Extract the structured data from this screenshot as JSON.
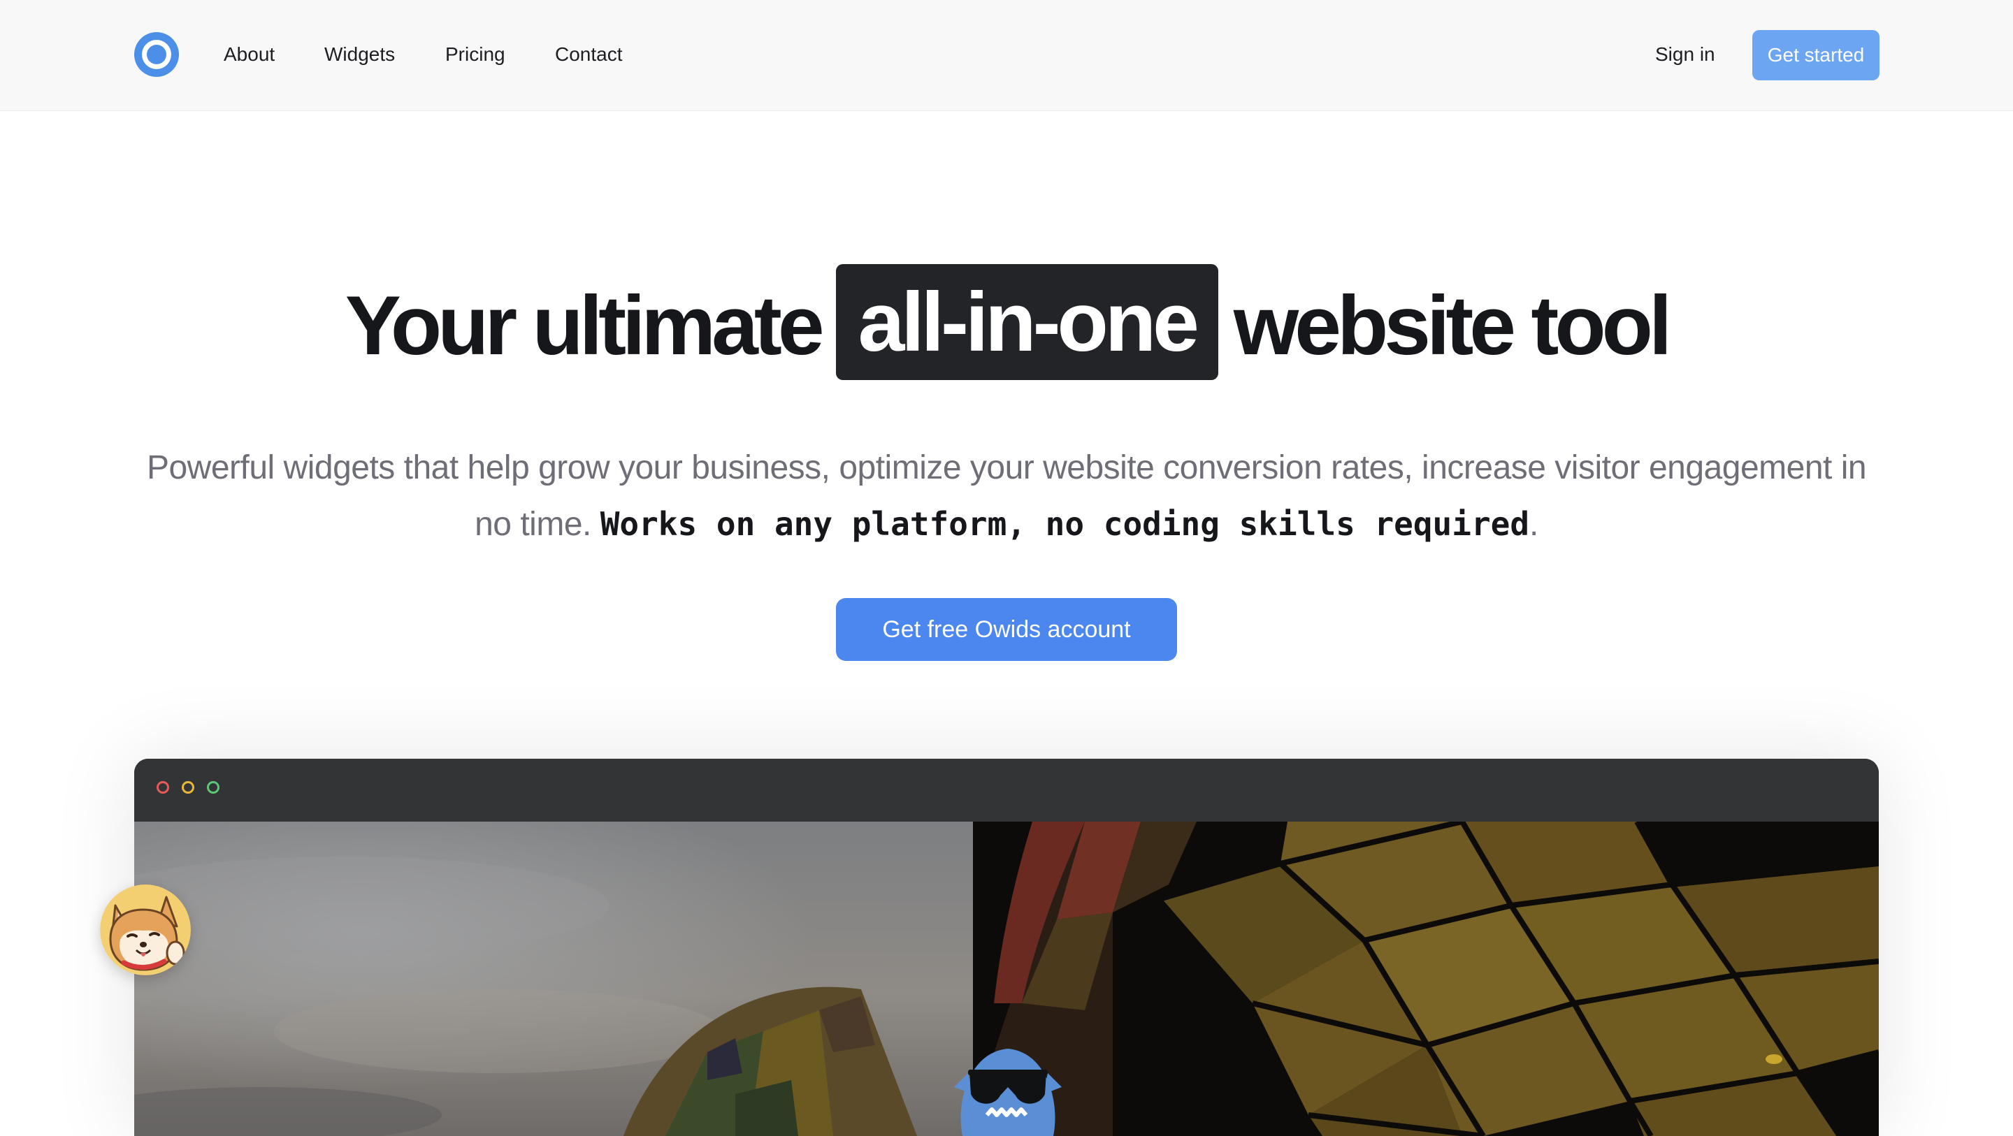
{
  "header": {
    "logo": "owids-logo-icon",
    "nav": {
      "about": "About",
      "widgets": "Widgets",
      "pricing": "Pricing",
      "contact": "Contact"
    },
    "sign_in": "Sign in",
    "get_started": "Get started"
  },
  "hero": {
    "title_pre": "Your ultimate",
    "title_highlight": "all-in-one",
    "title_post": "website tool",
    "subtitle_plain": "Powerful widgets that help grow your business, optimize your website conversion rates, increase visitor engagement in no time.",
    "subtitle_bold": "Works on any platform, no coding skills required",
    "subtitle_end": ".",
    "cta": "Get free Owids account"
  },
  "browser": {
    "window_controls": [
      "close",
      "minimize",
      "maximize"
    ],
    "content_image": "hot-air-balloon-photo",
    "mascot": "sunglasses-mascot-icon"
  },
  "avatar": {
    "icon": "dog-mascot-avatar-icon"
  },
  "colors": {
    "accent": "#4b87ef",
    "accent_light": "#6ca6f3",
    "highlight_bg": "#232428",
    "header_bg": "#f8f8f9",
    "text_dark": "#16171a",
    "text_muted": "#6e6f76"
  }
}
